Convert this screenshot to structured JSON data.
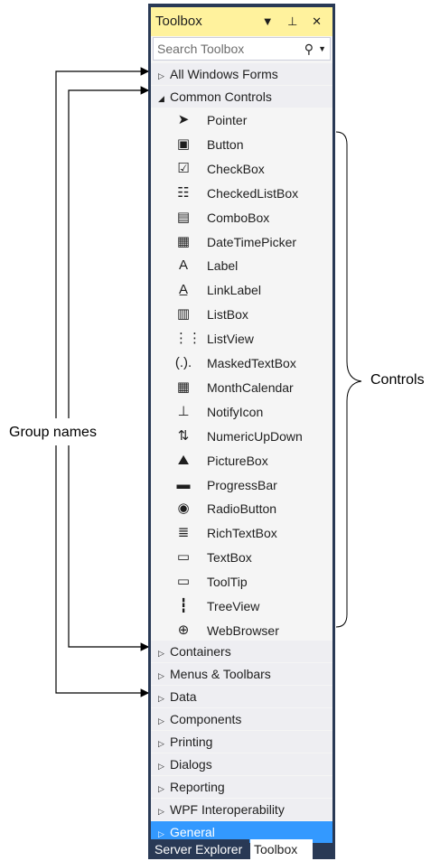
{
  "toolbox": {
    "title": "Toolbox",
    "title_buttons": "▼ ⊥ ✕",
    "search_placeholder": "Search Toolbox",
    "groups_top": [
      {
        "label": "All Windows Forms",
        "expanded": false
      },
      {
        "label": "Common Controls",
        "expanded": true
      }
    ],
    "items": [
      {
        "label": "Pointer",
        "icon": "pointer-icon",
        "glyph": "➤"
      },
      {
        "label": "Button",
        "icon": "button-icon",
        "glyph": "▣"
      },
      {
        "label": "CheckBox",
        "icon": "checkbox-icon",
        "glyph": "☑"
      },
      {
        "label": "CheckedListBox",
        "icon": "checkedlistbox-icon",
        "glyph": "☷"
      },
      {
        "label": "ComboBox",
        "icon": "combobox-icon",
        "glyph": "▤"
      },
      {
        "label": "DateTimePicker",
        "icon": "datetimepicker-icon",
        "glyph": "▦"
      },
      {
        "label": "Label",
        "icon": "label-icon",
        "glyph": "A"
      },
      {
        "label": "LinkLabel",
        "icon": "linklabel-icon",
        "glyph": "A̲"
      },
      {
        "label": "ListBox",
        "icon": "listbox-icon",
        "glyph": "▥"
      },
      {
        "label": "ListView",
        "icon": "listview-icon",
        "glyph": "⋮⋮"
      },
      {
        "label": "MaskedTextBox",
        "icon": "maskedtextbox-icon",
        "glyph": "(.)."
      },
      {
        "label": "MonthCalendar",
        "icon": "monthcalendar-icon",
        "glyph": "▦"
      },
      {
        "label": "NotifyIcon",
        "icon": "notifyicon-icon",
        "glyph": "⊥"
      },
      {
        "label": "NumericUpDown",
        "icon": "numericupdown-icon",
        "glyph": "⇅"
      },
      {
        "label": "PictureBox",
        "icon": "picturebox-icon",
        "glyph": "⛰"
      },
      {
        "label": "ProgressBar",
        "icon": "progressbar-icon",
        "glyph": "▬"
      },
      {
        "label": "RadioButton",
        "icon": "radiobutton-icon",
        "glyph": "◉"
      },
      {
        "label": "RichTextBox",
        "icon": "richtextbox-icon",
        "glyph": "≣"
      },
      {
        "label": "TextBox",
        "icon": "textbox-icon",
        "glyph": "▭"
      },
      {
        "label": "ToolTip",
        "icon": "tooltip-icon",
        "glyph": "▭"
      },
      {
        "label": "TreeView",
        "icon": "treeview-icon",
        "glyph": "┇"
      },
      {
        "label": "WebBrowser",
        "icon": "webbrowser-icon",
        "glyph": "⊕"
      }
    ],
    "groups_bottom": [
      {
        "label": "Containers",
        "selected": false
      },
      {
        "label": "Menus & Toolbars",
        "selected": false
      },
      {
        "label": "Data",
        "selected": false
      },
      {
        "label": "Components",
        "selected": false
      },
      {
        "label": "Printing",
        "selected": false
      },
      {
        "label": "Dialogs",
        "selected": false
      },
      {
        "label": "Reporting",
        "selected": false
      },
      {
        "label": "WPF Interoperability",
        "selected": false
      },
      {
        "label": "General",
        "selected": true
      }
    ],
    "tabs": [
      {
        "label": "Server Explorer",
        "active": false
      },
      {
        "label": "Toolbox",
        "active": true
      }
    ]
  },
  "annotations": {
    "group_names": "Group names",
    "controls": "Controls"
  },
  "colors": {
    "title_bar": "#fff29d",
    "selected": "#3399ff",
    "frame": "#293955"
  }
}
